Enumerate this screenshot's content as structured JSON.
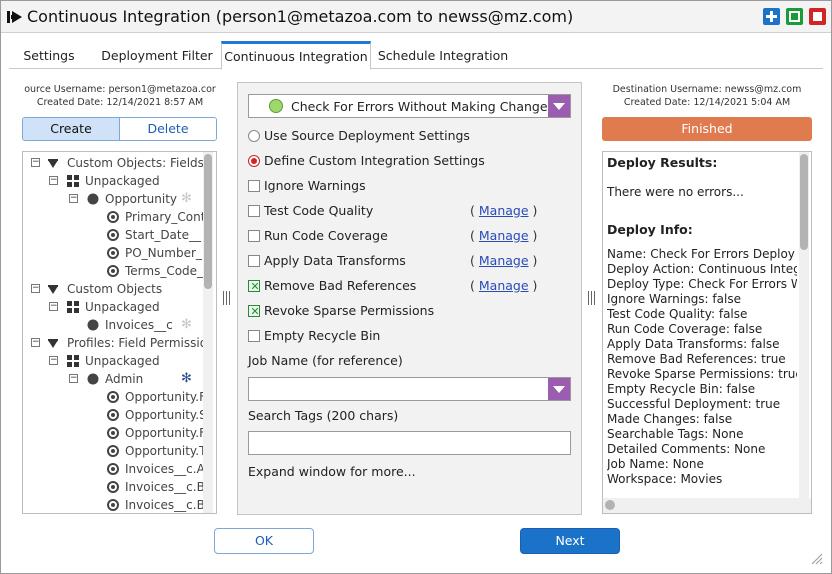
{
  "window": {
    "title": "Continuous Integration (person1@metazoa.com to newss@mz.com)"
  },
  "tabs": [
    {
      "label": "Settings",
      "active": false
    },
    {
      "label": "Deployment Filter",
      "active": false
    },
    {
      "label": "Continuous Integration",
      "active": true
    },
    {
      "label": "Schedule Integration",
      "active": false
    }
  ],
  "source": {
    "username": "ource Username: person1@metazoa.cor",
    "created": "Created Date: 12/14/2021 8:57 AM",
    "create_label": "Create",
    "delete_label": "Delete"
  },
  "tree": [
    {
      "label": "Custom Objects: Fields",
      "icon": "object-icon"
    },
    {
      "label": "Unpackaged",
      "icon": "package-icon"
    },
    {
      "label": "Opportunity",
      "icon": "circle-icon"
    },
    {
      "label": "Primary_Cont",
      "icon": "radio-icon"
    },
    {
      "label": "Start_Date__",
      "icon": "radio-icon"
    },
    {
      "label": "PO_Number_",
      "icon": "radio-icon"
    },
    {
      "label": "Terms_Code_",
      "icon": "radio-icon"
    },
    {
      "label": "Custom Objects",
      "icon": "object-icon"
    },
    {
      "label": "Unpackaged",
      "icon": "package-icon"
    },
    {
      "label": "Invoices__c",
      "icon": "circle-icon"
    },
    {
      "label": "Profiles: Field Permissio",
      "icon": "object-icon"
    },
    {
      "label": "Unpackaged",
      "icon": "package-icon"
    },
    {
      "label": "Admin",
      "icon": "circle-icon"
    },
    {
      "label": "Opportunity.F",
      "icon": "radio-icon"
    },
    {
      "label": "Opportunity.S",
      "icon": "radio-icon"
    },
    {
      "label": "Opportunity.F",
      "icon": "radio-icon"
    },
    {
      "label": "Opportunity.T",
      "icon": "radio-icon"
    },
    {
      "label": "Invoices__c.A",
      "icon": "radio-icon"
    },
    {
      "label": "Invoices__c.B",
      "icon": "radio-icon"
    },
    {
      "label": "Invoices__c.B",
      "icon": "radio-icon"
    }
  ],
  "integration": {
    "action_selected": "Check For Errors Without Making Changes",
    "use_source_label": "Use Source Deployment Settings",
    "define_custom_label": "Define Custom Integration Settings",
    "options": [
      {
        "label": "Ignore Warnings",
        "checked": false,
        "manage": false
      },
      {
        "label": "Test Code Quality",
        "checked": false,
        "manage": true
      },
      {
        "label": "Run Code Coverage",
        "checked": false,
        "manage": true
      },
      {
        "label": "Apply Data Transforms",
        "checked": false,
        "manage": true
      },
      {
        "label": "Remove Bad References",
        "checked": true,
        "manage": true
      },
      {
        "label": "Revoke Sparse Permissions",
        "checked": true,
        "manage": false
      },
      {
        "label": "Empty Recycle Bin",
        "checked": false,
        "manage": false
      }
    ],
    "manage_label": "Manage",
    "manage_open": "(",
    "manage_close": ")",
    "job_name_label": "Job Name (for reference)",
    "job_name_value": "",
    "search_tags_label": "Search Tags (200 chars)",
    "search_tags_value": "",
    "expand_hint": "Expand window for more..."
  },
  "destination": {
    "username": "Destination Username: newss@mz.com",
    "created": "Created Date: 12/14/2021 5:04 AM",
    "status": "Finished",
    "status_color": "#e07a4f"
  },
  "results": {
    "deploy_results_heading": "Deploy Results:",
    "no_errors": "There were no errors...",
    "deploy_info_heading": "Deploy Info:",
    "lines": [
      "Name: Check For Errors Deploy F",
      "Deploy Action: Continuous Integ",
      "Deploy Type: Check For Errors W",
      "Ignore Warnings: false",
      "Test Code Quality: false",
      "Run Code Coverage: false",
      "Apply Data Transforms: false",
      "Remove Bad References: true",
      "Revoke Sparse Permissions: true",
      "Empty Recycle Bin: false",
      "Successful Deployment: true",
      "Made Changes: false",
      "Searchable Tags: None",
      "Detailed Comments: None",
      "Job Name: None",
      "Workspace: Movies"
    ]
  },
  "buttons": {
    "ok": "OK",
    "next": "Next"
  },
  "colors": {
    "accent_blue": "#1a73c8",
    "dropdown_purple": "#9b5db0",
    "close_red": "#d42323",
    "restore_green": "#1a9a3a"
  }
}
